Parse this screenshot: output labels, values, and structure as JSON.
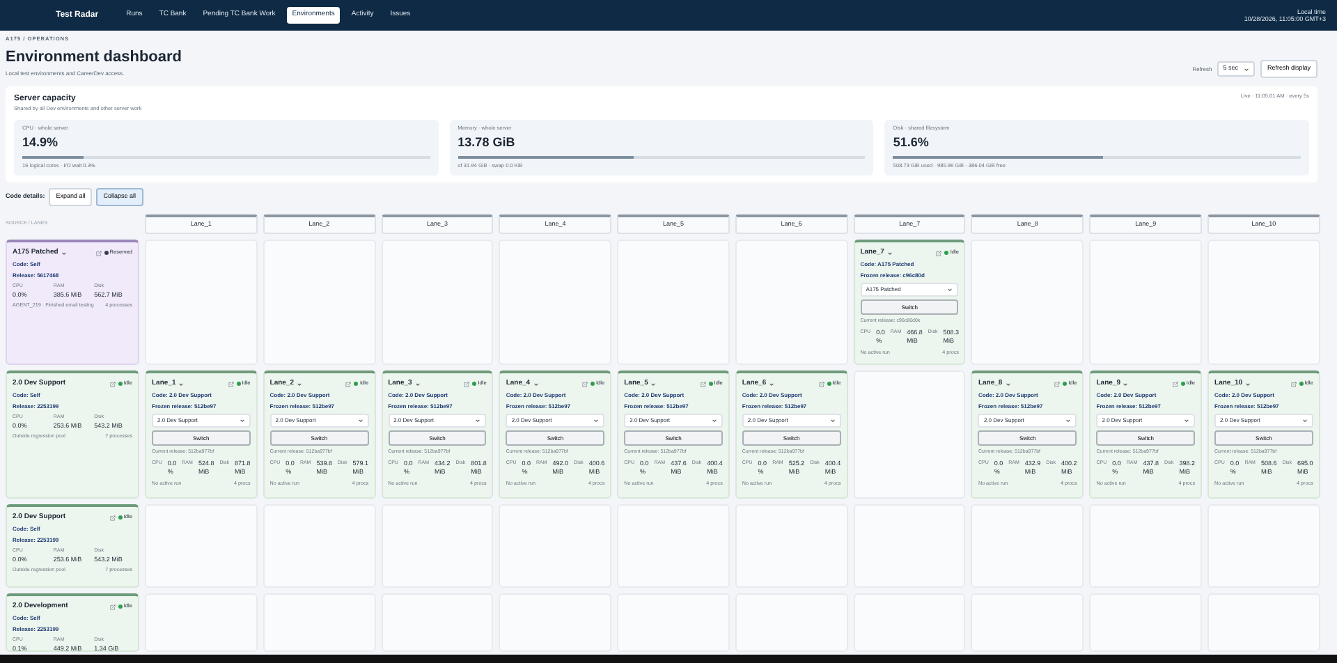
{
  "navbar": {
    "brand": "Test Radar",
    "links": [
      {
        "label": "Runs",
        "selected": false
      },
      {
        "label": "TC Bank",
        "selected": false
      },
      {
        "label": "Pending TC Bank Work",
        "selected": false
      },
      {
        "label": "Environments",
        "selected": true
      },
      {
        "label": "Activity",
        "selected": false
      },
      {
        "label": "Issues",
        "selected": false
      }
    ],
    "clock_label": "Local time",
    "clock": "10/28/2026, 11:05:00 GMT+3"
  },
  "header": {
    "breadcrumb": "A175 / OPERATIONS",
    "title": "Environment dashboard",
    "subtitle": "Local test environments and CareerDev access.",
    "refresh_label": "Refresh",
    "refresh_value": "5 sec",
    "refresh_button": "Refresh display"
  },
  "capacity": {
    "title": "Server capacity",
    "subtitle": "Shared by all Dev environments and other server work",
    "live": "Live · 11:05:01 AM · every 5s",
    "metrics": [
      {
        "label": "CPU · whole server",
        "value": "14.9%",
        "level": 0.149,
        "note": "16 logical cores · I/O wait 0.3%"
      },
      {
        "label": "Memory · whole server",
        "value": "13.78 GiB",
        "level": 0.43,
        "note": "of 31.94 GiB · swap 0.0 KiB"
      },
      {
        "label": "Disk · shared filesystem",
        "value": "51.6%",
        "level": 0.516,
        "note": "508.73 GiB used · 985.96 GiB · 386.04 GiB free"
      }
    ]
  },
  "code_details": {
    "label": "Code details:",
    "buttons": [
      {
        "label": "Expand all",
        "selected": false
      },
      {
        "label": "Collapse all",
        "selected": true
      }
    ]
  },
  "grid": {
    "corner": "SOURCE / LANES",
    "lanes": [
      "Lane_1",
      "Lane_2",
      "Lane_3",
      "Lane_4",
      "Lane_5",
      "Lane_6",
      "Lane_7",
      "Lane_8",
      "Lane_9",
      "Lane_10"
    ],
    "rows": [
      {
        "source": {
          "name": "A175 Patched",
          "status": "Reserved",
          "kind": "reserved",
          "code": "Code: Self",
          "release": "Release: 5617468",
          "stats": [
            {
              "label": "CPU",
              "value": "0.0%"
            },
            {
              "label": "RAM",
              "value": "385.6 MiB"
            },
            {
              "label": "Disk",
              "value": "562.7 MiB"
            }
          ],
          "note": "AGENT_219 · Finished email testing",
          "procs": "4 processes"
        },
        "cells": [
          {
            "kind": "empty"
          },
          {
            "kind": "empty"
          },
          {
            "kind": "empty"
          },
          {
            "kind": "empty"
          },
          {
            "kind": "empty"
          },
          {
            "kind": "empty"
          },
          {
            "kind": "lane",
            "name": "Lane_7",
            "status": "Idle",
            "code": "Code: A175 Patched",
            "frozen": "Frozen release: c96c80d",
            "select": "A175 Patched",
            "button": "Switch",
            "current": "Current release: c96c80d0e",
            "stats": [
              {
                "label": "CPU",
                "value": "0.0 %"
              },
              {
                "label": "RAM",
                "value": "466.8 MiB"
              },
              {
                "label": "Disk",
                "value": "508.3 MiB"
              }
            ],
            "run": "No active run",
            "procs": "4 procs"
          },
          {
            "kind": "empty"
          },
          {
            "kind": "empty"
          },
          {
            "kind": "empty"
          }
        ]
      },
      {
        "source": {
          "name": "2.0 Dev Support",
          "status": "Idle",
          "kind": "idle",
          "code": "Code: Self",
          "release": "Release: 2253199",
          "stats": [
            {
              "label": "CPU",
              "value": "0.0%"
            },
            {
              "label": "RAM",
              "value": "253.6 MiB"
            },
            {
              "label": "Disk",
              "value": "543.2 MiB"
            }
          ],
          "note": "Outside regression pool",
          "procs": "7 processes"
        },
        "cells": [
          {
            "kind": "lane",
            "name": "Lane_1",
            "status": "Idle",
            "code": "Code: 2.0 Dev Support",
            "frozen": "Frozen release: 512be97",
            "select": "2.0 Dev Support",
            "button": "Switch",
            "current": "Current release: 512ba977bf",
            "stats": [
              {
                "label": "CPU",
                "value": "0.0 %"
              },
              {
                "label": "RAM",
                "value": "524.8 MiB"
              },
              {
                "label": "Disk",
                "value": "871.8 MiB"
              }
            ],
            "run": "No active run",
            "procs": "4 procs"
          },
          {
            "kind": "lane",
            "name": "Lane_2",
            "status": "Idle",
            "code": "Code: 2.0 Dev Support",
            "frozen": "Frozen release: 512be97",
            "select": "2.0 Dev Support",
            "button": "Switch",
            "current": "Current release: 512ba977bf",
            "stats": [
              {
                "label": "CPU",
                "value": "0.0 %"
              },
              {
                "label": "RAM",
                "value": "539.8 MiB"
              },
              {
                "label": "Disk",
                "value": "579.1 MiB"
              }
            ],
            "run": "No active run",
            "procs": "4 procs"
          },
          {
            "kind": "lane",
            "name": "Lane_3",
            "status": "Idle",
            "code": "Code: 2.0 Dev Support",
            "frozen": "Frozen release: 512be97",
            "select": "2.0 Dev Support",
            "button": "Switch",
            "current": "Current release: 512ba977bf",
            "stats": [
              {
                "label": "CPU",
                "value": "0.0 %"
              },
              {
                "label": "RAM",
                "value": "434.2 MiB"
              },
              {
                "label": "Disk",
                "value": "801.8 MiB"
              }
            ],
            "run": "No active run",
            "procs": "4 procs"
          },
          {
            "kind": "lane",
            "name": "Lane_4",
            "status": "Idle",
            "code": "Code: 2.0 Dev Support",
            "frozen": "Frozen release: 512be97",
            "select": "2.0 Dev Support",
            "button": "Switch",
            "current": "Current release: 512ba977bf",
            "stats": [
              {
                "label": "CPU",
                "value": "0.0 %"
              },
              {
                "label": "RAM",
                "value": "492.0 MiB"
              },
              {
                "label": "Disk",
                "value": "400.6 MiB"
              }
            ],
            "run": "No active run",
            "procs": "4 procs"
          },
          {
            "kind": "lane",
            "name": "Lane_5",
            "status": "Idle",
            "code": "Code: 2.0 Dev Support",
            "frozen": "Frozen release: 512be97",
            "select": "2.0 Dev Support",
            "button": "Switch",
            "current": "Current release: 512ba977bf",
            "stats": [
              {
                "label": "CPU",
                "value": "0.0 %"
              },
              {
                "label": "RAM",
                "value": "437.6 MiB"
              },
              {
                "label": "Disk",
                "value": "400.4 MiB"
              }
            ],
            "run": "No active run",
            "procs": "4 procs"
          },
          {
            "kind": "lane",
            "name": "Lane_6",
            "status": "Idle",
            "code": "Code: 2.0 Dev Support",
            "frozen": "Frozen release: 512be97",
            "select": "2.0 Dev Support",
            "button": "Switch",
            "current": "Current release: 512ba977bf",
            "stats": [
              {
                "label": "CPU",
                "value": "0.0 %"
              },
              {
                "label": "RAM",
                "value": "525.2 MiB"
              },
              {
                "label": "Disk",
                "value": "400.4 MiB"
              }
            ],
            "run": "No active run",
            "procs": "4 procs"
          },
          {
            "kind": "empty"
          },
          {
            "kind": "lane",
            "name": "Lane_8",
            "status": "Idle",
            "code": "Code: 2.0 Dev Support",
            "frozen": "Frozen release: 512be97",
            "select": "2.0 Dev Support",
            "button": "Switch",
            "current": "Current release: 512ba977bf",
            "stats": [
              {
                "label": "CPU",
                "value": "0.0 %"
              },
              {
                "label": "RAM",
                "value": "432.9 MiB"
              },
              {
                "label": "Disk",
                "value": "400.2 MiB"
              }
            ],
            "run": "No active run",
            "procs": "4 procs"
          },
          {
            "kind": "lane",
            "name": "Lane_9",
            "status": "Idle",
            "code": "Code: 2.0 Dev Support",
            "frozen": "Frozen release: 512be97",
            "select": "2.0 Dev Support",
            "button": "Switch",
            "current": "Current release: 512ba977bf",
            "stats": [
              {
                "label": "CPU",
                "value": "0.0 %"
              },
              {
                "label": "RAM",
                "value": "437.8 MiB"
              },
              {
                "label": "Disk",
                "value": "398.2 MiB"
              }
            ],
            "run": "No active run",
            "procs": "4 procs"
          },
          {
            "kind": "lane",
            "name": "Lane_10",
            "status": "Idle",
            "code": "Code: 2.0 Dev Support",
            "frozen": "Frozen release: 512be97",
            "select": "2.0 Dev Support",
            "button": "Switch",
            "current": "Current release: 512ba977bf",
            "stats": [
              {
                "label": "CPU",
                "value": "0.0 %"
              },
              {
                "label": "RAM",
                "value": "508.6 MiB"
              },
              {
                "label": "Disk",
                "value": "695.0 MiB"
              }
            ],
            "run": "No active run",
            "procs": "4 procs"
          }
        ]
      },
      {
        "source": {
          "name": "2.0 Dev Support",
          "status": "Idle",
          "kind": "idle",
          "code": "Code: Self",
          "release": "Release: 2253199",
          "stats": [
            {
              "label": "CPU",
              "value": "0.0%"
            },
            {
              "label": "RAM",
              "value": "253.6 MiB"
            },
            {
              "label": "Disk",
              "value": "543.2 MiB"
            }
          ],
          "note": "Outside regression pool",
          "procs": "7 processes"
        },
        "cells": [
          {
            "kind": "empty"
          },
          {
            "kind": "empty"
          },
          {
            "kind": "empty"
          },
          {
            "kind": "empty"
          },
          {
            "kind": "empty"
          },
          {
            "kind": "empty"
          },
          {
            "kind": "empty"
          },
          {
            "kind": "empty"
          },
          {
            "kind": "empty"
          },
          {
            "kind": "empty"
          }
        ]
      },
      {
        "source": {
          "name": "2.0 Development",
          "status": "Idle",
          "kind": "idle",
          "code": "Code: Self",
          "release": "Release: 2253199",
          "stats": [
            {
              "label": "CPU",
              "value": "0.1%"
            },
            {
              "label": "RAM",
              "value": "449.2 MiB"
            },
            {
              "label": "Disk",
              "value": "1.34 GiB"
            }
          ]
        },
        "cells": [
          {
            "kind": "empty"
          },
          {
            "kind": "empty"
          },
          {
            "kind": "empty"
          },
          {
            "kind": "empty"
          },
          {
            "kind": "empty"
          },
          {
            "kind": "empty"
          },
          {
            "kind": "empty"
          },
          {
            "kind": "empty"
          },
          {
            "kind": "empty"
          },
          {
            "kind": "empty"
          }
        ]
      }
    ]
  }
}
